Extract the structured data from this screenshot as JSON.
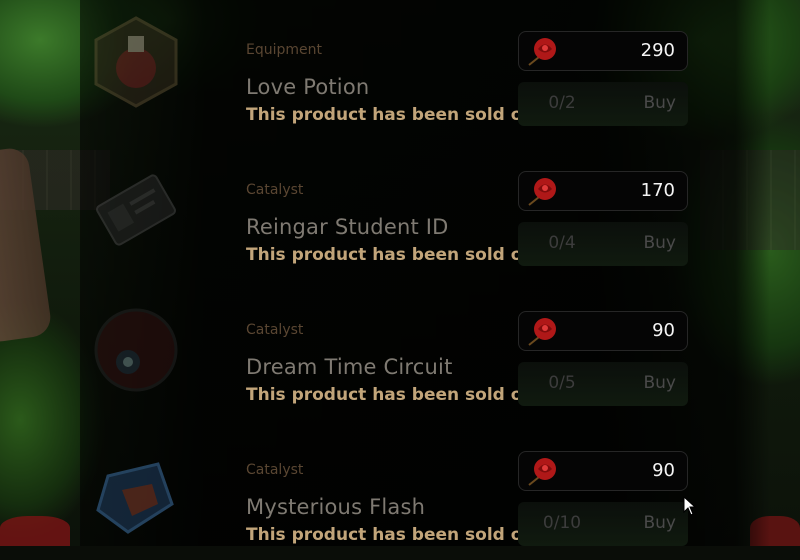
{
  "items": [
    {
      "category": "Equipment",
      "name": "Love Potion",
      "status": "This product has been sold out",
      "price": "290",
      "stock": "0/2",
      "buy_label": "Buy",
      "thumb_icon": "potion-icon"
    },
    {
      "category": "Catalyst",
      "name": "Reingar Student ID",
      "status": "This product has been sold out",
      "price": "170",
      "stock": "0/4",
      "buy_label": "Buy",
      "thumb_icon": "id-card-icon"
    },
    {
      "category": "Catalyst",
      "name": "Dream Time Circuit",
      "status": "This product has been sold out",
      "price": "90",
      "stock": "0/5",
      "buy_label": "Buy",
      "thumb_icon": "circuit-orb-icon"
    },
    {
      "category": "Catalyst",
      "name": "Mysterious Flash",
      "status": "This product has been sold out",
      "price": "90",
      "stock": "0/10",
      "buy_label": "Buy",
      "thumb_icon": "crystal-flash-icon"
    }
  ],
  "currency_icon": "rose-icon",
  "colors": {
    "category": "#5a4632",
    "soldout": "#c2a57a",
    "name": "#7f7a72",
    "price_bg": "#050505"
  }
}
